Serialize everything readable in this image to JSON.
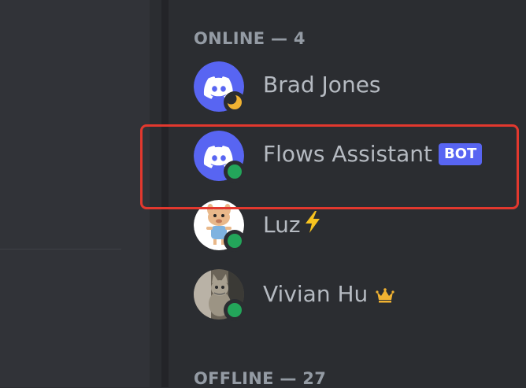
{
  "online_header": "ONLINE — 4",
  "offline_header": "OFFLINE — 27",
  "members": [
    {
      "name": "Brad Jones",
      "avatar": "discord-logo-avatar",
      "status": "idle",
      "badge": ""
    },
    {
      "name": "Flows Assistant",
      "avatar": "discord-logo-avatar",
      "status": "online",
      "badge": "BOT"
    },
    {
      "name": "Luz",
      "avatar": "cartoon-character-avatar",
      "status": "online",
      "suffix_icon": "lightning-bolt-icon"
    },
    {
      "name": "Vivian Hu",
      "avatar": "cat-photo-avatar",
      "status": "online",
      "suffix_icon": "crown-icon"
    }
  ],
  "colors": {
    "online": "#23a55a",
    "idle": "#f0b232",
    "blurple": "#5865f2",
    "highlight": "#e2382e"
  }
}
